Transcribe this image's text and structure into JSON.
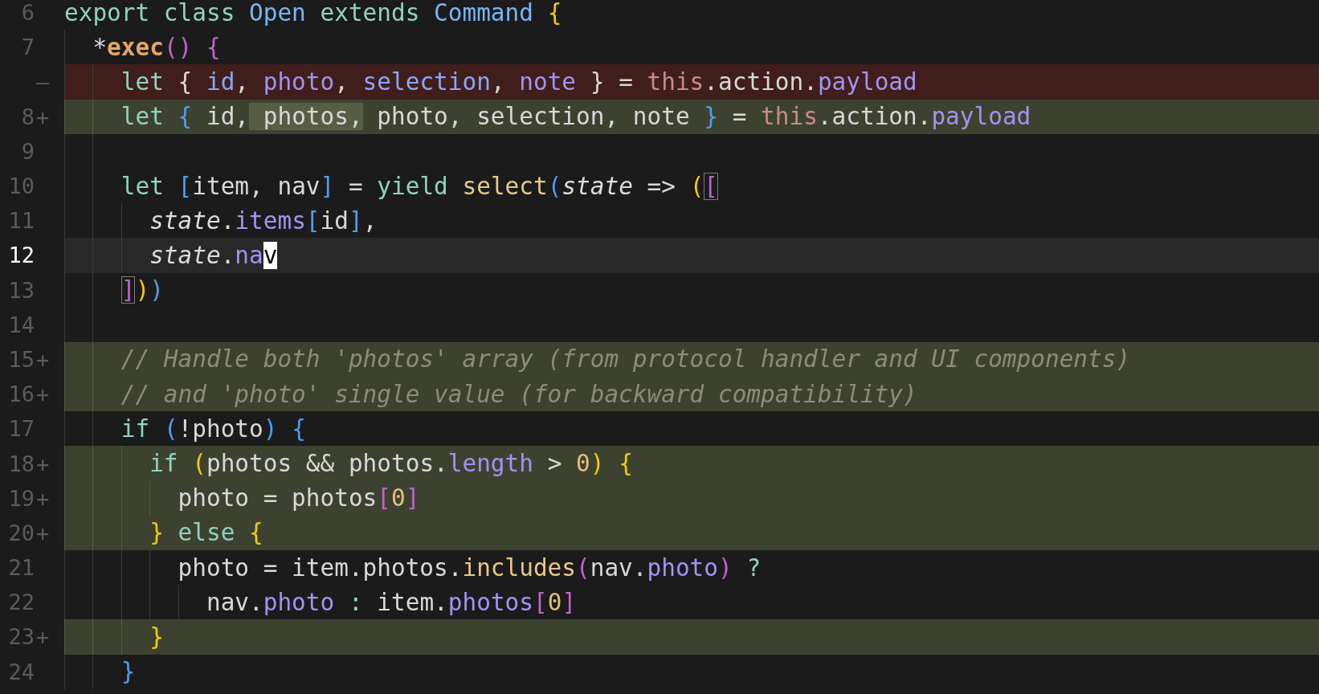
{
  "lines": [
    {
      "number": "6",
      "kind": "context",
      "current": false,
      "tokens": [
        {
          "text": "export class ",
          "kind": "kw"
        },
        {
          "text": "Open",
          "kind": "type"
        },
        {
          "text": " extends ",
          "kind": "kw"
        },
        {
          "text": "Command ",
          "kind": "type"
        },
        {
          "text": "{",
          "kind": "y"
        }
      ]
    },
    {
      "number": "7",
      "kind": "context",
      "current": false,
      "tokens": [
        {
          "text": "  *",
          "kind": "plain"
        },
        {
          "text": "exec",
          "kind": "fn"
        },
        {
          "text": "() ",
          "kind": "p"
        },
        {
          "text": "{",
          "kind": "p"
        }
      ]
    },
    {
      "marker": "—",
      "kind": "removed",
      "current": false,
      "tokens": [
        {
          "text": "    let ",
          "kind": "kw"
        },
        {
          "text": "{ ",
          "kind": "plain"
        },
        {
          "text": "id",
          "kind": "var"
        },
        {
          "text": ", ",
          "kind": "plain"
        },
        {
          "text": "photo",
          "kind": "prop"
        },
        {
          "text": ", ",
          "kind": "plain"
        },
        {
          "text": "selection",
          "kind": "var"
        },
        {
          "text": ", ",
          "kind": "plain"
        },
        {
          "text": "note",
          "kind": "prop"
        },
        {
          "text": " } = ",
          "kind": "plain"
        },
        {
          "text": "this",
          "kind": "this"
        },
        {
          "text": ".action.",
          "kind": "plain"
        },
        {
          "text": "payload",
          "kind": "prop"
        }
      ]
    },
    {
      "number": "8",
      "marker": "+",
      "kind": "added",
      "current": false,
      "tokens": [
        {
          "text": "    let ",
          "kind": "kw"
        },
        {
          "text": "{",
          "kind": "b"
        },
        {
          "text": " id,",
          "kind": "plain"
        },
        {
          "text": " photos,",
          "kind": "plain",
          "highlight": true
        },
        {
          "text": " photo, selection, note ",
          "kind": "plain"
        },
        {
          "text": "}",
          "kind": "b"
        },
        {
          "text": " = ",
          "kind": "plain"
        },
        {
          "text": "this",
          "kind": "this"
        },
        {
          "text": ".action.",
          "kind": "plain"
        },
        {
          "text": "payload",
          "kind": "prop"
        }
      ]
    },
    {
      "number": "9",
      "kind": "context",
      "current": false
    },
    {
      "number": "10",
      "kind": "context",
      "current": false,
      "tokens": [
        {
          "text": "    let ",
          "kind": "kw"
        },
        {
          "text": "[",
          "kind": "b"
        },
        {
          "text": "item, nav",
          "kind": "plain"
        },
        {
          "text": "]",
          "kind": "b"
        },
        {
          "text": " = ",
          "kind": "plain"
        },
        {
          "text": "yield ",
          "kind": "kw"
        },
        {
          "text": "select",
          "kind": "call"
        },
        {
          "text": "(",
          "kind": "b"
        },
        {
          "text": "state",
          "kind": "param"
        },
        {
          "text": " => ",
          "kind": "plain"
        },
        {
          "text": "(",
          "kind": "y"
        },
        {
          "text": "[",
          "kind": "p",
          "matched": true
        }
      ]
    },
    {
      "number": "11",
      "kind": "context",
      "current": false,
      "tokens": [
        {
          "text": "      state",
          "kind": "param"
        },
        {
          "text": ".",
          "kind": "plain"
        },
        {
          "text": "items",
          "kind": "prop"
        },
        {
          "text": "[",
          "kind": "b"
        },
        {
          "text": "id",
          "kind": "plain"
        },
        {
          "text": "]",
          "kind": "b"
        },
        {
          "text": ",",
          "kind": "plain"
        }
      ]
    },
    {
      "number": "12",
      "kind": "context",
      "current": true,
      "tokens": [
        {
          "text": "      state",
          "kind": "param"
        },
        {
          "text": ".",
          "kind": "plain"
        },
        {
          "text": "na",
          "kind": "prop"
        },
        {
          "text": "v",
          "kind": "cursor"
        }
      ]
    },
    {
      "number": "13",
      "kind": "context",
      "current": false,
      "tokens": [
        {
          "text": "    ]",
          "kind": "p",
          "matched": true
        },
        {
          "text": ")",
          "kind": "y"
        },
        {
          "text": ")",
          "kind": "b"
        }
      ]
    },
    {
      "number": "14",
      "kind": "context",
      "current": false
    },
    {
      "number": "15",
      "marker": "+",
      "kind": "added",
      "current": false,
      "tokens": [
        {
          "text": "    // Handle both 'photos' array (from protocol handler and UI components)",
          "kind": "comment"
        }
      ]
    },
    {
      "number": "16",
      "marker": "+",
      "kind": "added",
      "current": false,
      "tokens": [
        {
          "text": "    // and 'photo' single value (for backward compatibility)",
          "kind": "comment"
        }
      ]
    },
    {
      "number": "17",
      "kind": "context",
      "current": false,
      "tokens": [
        {
          "text": "    if ",
          "kind": "kw"
        },
        {
          "text": "(",
          "kind": "b"
        },
        {
          "text": "!photo",
          "kind": "plain"
        },
        {
          "text": ") ",
          "kind": "b"
        },
        {
          "text": "{",
          "kind": "b"
        }
      ]
    },
    {
      "number": "18",
      "marker": "+",
      "kind": "added",
      "current": false,
      "tokens": [
        {
          "text": "      if ",
          "kind": "kw"
        },
        {
          "text": "(",
          "kind": "y"
        },
        {
          "text": "photos && photos.",
          "kind": "plain"
        },
        {
          "text": "length",
          "kind": "prop"
        },
        {
          "text": " > ",
          "kind": "plain"
        },
        {
          "text": "0",
          "kind": "num"
        },
        {
          "text": ") ",
          "kind": "y"
        },
        {
          "text": "{",
          "kind": "y"
        }
      ]
    },
    {
      "number": "19",
      "marker": "+",
      "kind": "added",
      "current": false,
      "tokens": [
        {
          "text": "        photo = photos",
          "kind": "plain"
        },
        {
          "text": "[",
          "kind": "p"
        },
        {
          "text": "0",
          "kind": "num"
        },
        {
          "text": "]",
          "kind": "p"
        }
      ]
    },
    {
      "number": "20",
      "marker": "+",
      "kind": "added",
      "current": false,
      "tokens": [
        {
          "text": "      }",
          "kind": "y"
        },
        {
          "text": " else ",
          "kind": "kw"
        },
        {
          "text": "{",
          "kind": "y"
        }
      ]
    },
    {
      "number": "21",
      "kind": "context",
      "current": false,
      "tokens": [
        {
          "text": "        photo = item.photos.",
          "kind": "plain"
        },
        {
          "text": "includes",
          "kind": "call"
        },
        {
          "text": "(",
          "kind": "p"
        },
        {
          "text": "nav.",
          "kind": "plain"
        },
        {
          "text": "photo",
          "kind": "prop"
        },
        {
          "text": ")",
          "kind": "p"
        },
        {
          "text": " ?",
          "kind": "kw"
        }
      ]
    },
    {
      "number": "22",
      "kind": "context",
      "current": false,
      "tokens": [
        {
          "text": "          nav.",
          "kind": "plain"
        },
        {
          "text": "photo",
          "kind": "prop"
        },
        {
          "text": " : ",
          "kind": "kw"
        },
        {
          "text": "item.",
          "kind": "plain"
        },
        {
          "text": "photos",
          "kind": "prop"
        },
        {
          "text": "[",
          "kind": "p"
        },
        {
          "text": "0",
          "kind": "num"
        },
        {
          "text": "]",
          "kind": "p"
        }
      ]
    },
    {
      "number": "23",
      "marker": "+",
      "kind": "added",
      "current": false,
      "tokens": [
        {
          "text": "      }",
          "kind": "y"
        }
      ]
    },
    {
      "number": "24",
      "kind": "context",
      "current": false,
      "tokens": [
        {
          "text": "    }",
          "kind": "b"
        }
      ]
    }
  ]
}
